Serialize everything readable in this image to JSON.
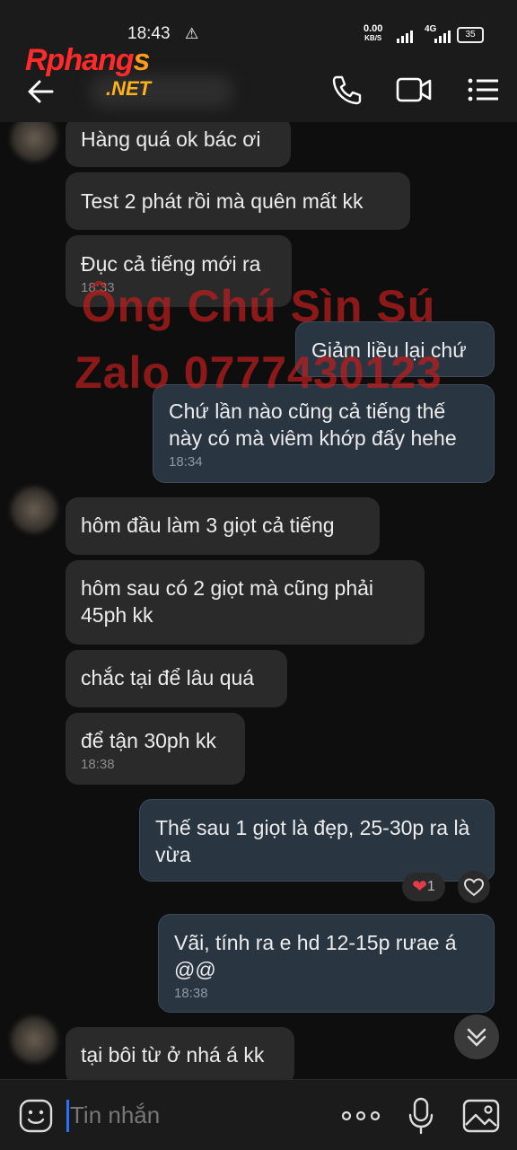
{
  "status_bar": {
    "time": "18:43",
    "net_speed_value": "0.00",
    "net_speed_unit": "KB/S",
    "network": "4G",
    "battery": "35"
  },
  "header": {
    "logo_part1": "Rphang",
    "logo_part2": "s",
    "logo_net": ".NET"
  },
  "watermark": {
    "line1": "Ông Chú Sìn Sú",
    "line2": "Zalo 0777430123"
  },
  "messages": [
    {
      "dir": "in",
      "text": "Hàng quá ok bác ơi"
    },
    {
      "dir": "in",
      "text": "Test 2 phát rồi mà quên mất kk"
    },
    {
      "dir": "in",
      "text": "Đục cả tiếng mới ra",
      "time": "18:33"
    },
    {
      "dir": "out",
      "text": "Giảm liều lại chứ"
    },
    {
      "dir": "out",
      "text": "Chứ lần nào cũng cả tiếng thế này có mà viêm khớp đấy hehe",
      "time": "18:34"
    },
    {
      "dir": "in",
      "text": "hôm đầu làm 3 giọt cả tiếng"
    },
    {
      "dir": "in",
      "text": "hôm sau có 2 giọt mà cũng phải 45ph kk"
    },
    {
      "dir": "in",
      "text": "chắc tại để lâu quá"
    },
    {
      "dir": "in",
      "text": "để tận 30ph kk",
      "time": "18:38"
    },
    {
      "dir": "out",
      "text": "Thế sau 1 giọt là đẹp, 25-30p ra là vừa"
    },
    {
      "dir": "out",
      "text": "Vãi, tính ra e hd 12-15p rưae á @@",
      "time": "18:38"
    },
    {
      "dir": "in",
      "text": "tại bôi từ ở nhá á kk"
    }
  ],
  "reactions": {
    "count": "1",
    "icon": "heart-icon"
  },
  "composer": {
    "placeholder": "Tin nhắn"
  }
}
